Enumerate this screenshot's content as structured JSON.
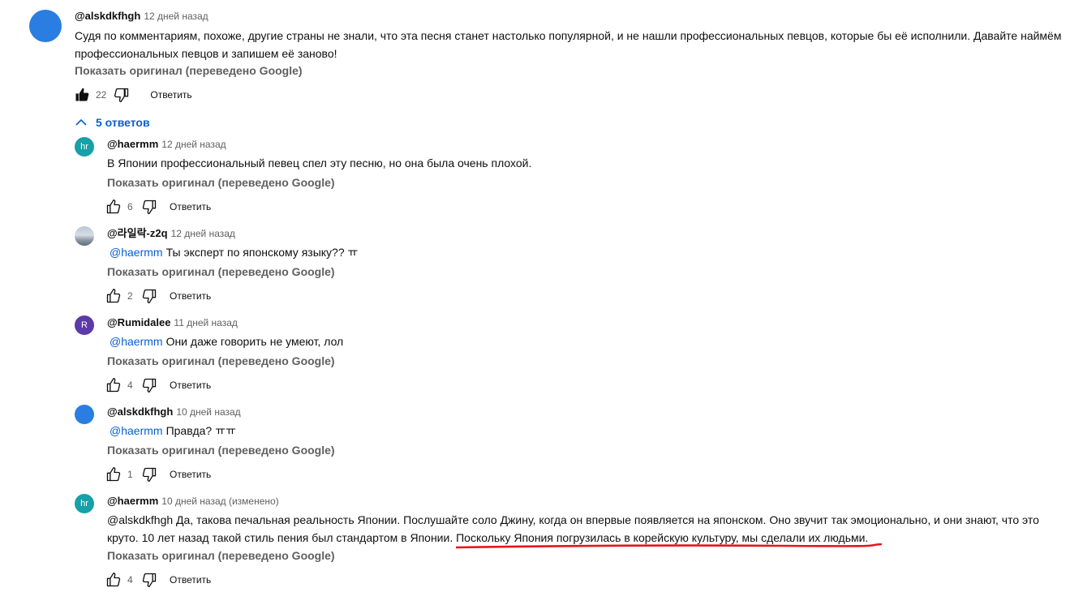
{
  "colors": {
    "link": "#065fd4",
    "muted": "#606060",
    "underline": "#e8141b"
  },
  "main_comment": {
    "author": "@alskdkfhgh",
    "time": "12 дней назад",
    "text": "Судя по комментариям, похоже, другие страны не знали, что эта песня станет настолько популярной, и не нашли профессиональных певцов, которые бы её исполнили. Давайте наймём профессиональных певцов и запишем её заново!",
    "translate_label": "Показать оригинал (переведено Google)",
    "likes": "22",
    "reply_label": "Ответить",
    "like_state": "liked"
  },
  "replies_toggle": {
    "label": "5 ответов",
    "icon": "chevron-up-icon"
  },
  "replies": [
    {
      "avatar_text": "hr",
      "avatar_color": "teal",
      "author": "@haermm",
      "time": "12 дней назад",
      "mention": "",
      "text": "В Японии профессиональный певец спел эту песню, но она была очень плохой.",
      "translate_label": "Показать оригинал (переведено Google)",
      "likes": "6",
      "reply_label": "Ответить"
    },
    {
      "avatar_text": "",
      "avatar_color": "photo",
      "author": "@라일락-z2q",
      "time": "12 дней назад",
      "mention": "@haermm",
      "text": "Ты эксперт по японскому языку?? ㅠ",
      "translate_label": "Показать оригинал (переведено Google)",
      "likes": "2",
      "reply_label": "Ответить"
    },
    {
      "avatar_text": "R",
      "avatar_color": "purple",
      "author": "@Rumidalee",
      "time": "11 дней назад",
      "mention": "@haermm",
      "text": "Они даже говорить не умеют, лол",
      "translate_label": "Показать оригинал (переведено Google)",
      "likes": "4",
      "reply_label": "Ответить"
    },
    {
      "avatar_text": "",
      "avatar_color": "blue",
      "author": "@alskdkfhgh",
      "time": "10 дней назад",
      "mention": "@haermm",
      "text": "Правда? ㅠㅠ",
      "translate_label": "Показать оригинал (переведено Google)",
      "likes": "1",
      "reply_label": "Ответить"
    },
    {
      "avatar_text": "hr",
      "avatar_color": "teal",
      "author": "@haermm",
      "time": "10 дней назад (изменено)",
      "mention": "",
      "text": "@alskdkfhgh Да, такова печальная реальность Японии. Послушайте соло Джину, когда он впервые появляется на японском. Оно звучит так эмоционально, и они знают, что это круто. 10 лет назад такой стиль пения был стандартом в Японии. Поскольку Япония погрузилась в корейскую культуру, мы сделали их людьми.",
      "translate_label": "Показать оригинал (переведено Google)",
      "likes": "4",
      "reply_label": "Ответить"
    }
  ]
}
